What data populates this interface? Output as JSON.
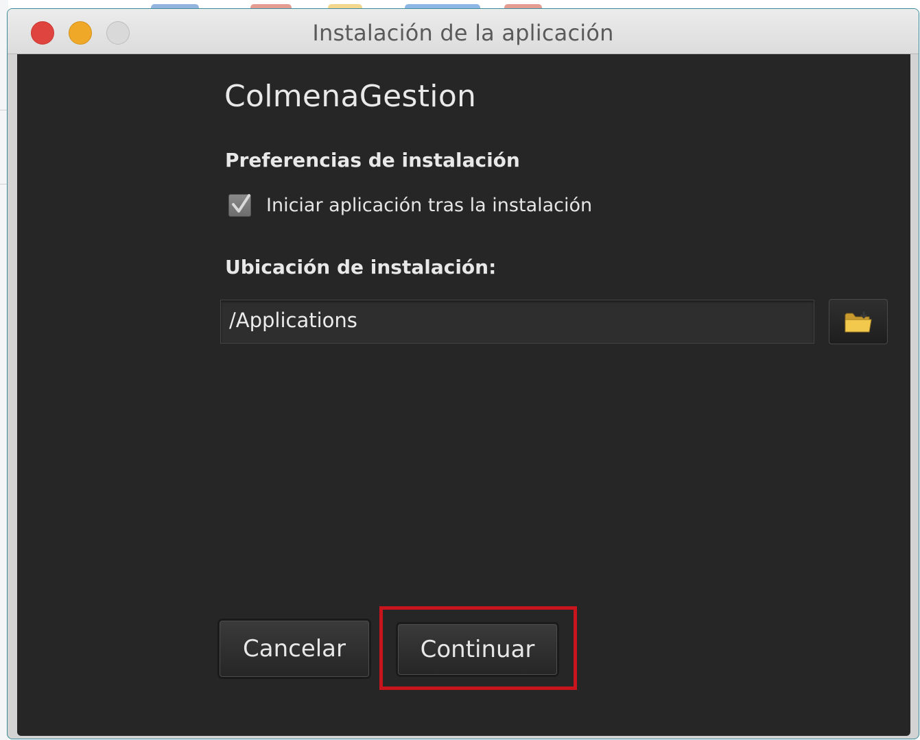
{
  "window": {
    "title": "Instalación de la aplicación"
  },
  "dialog": {
    "app_name": "ColmenaGestion",
    "preferences_heading": "Preferencias de instalación",
    "launch_after_install_label": "Iniciar aplicación tras la instalación",
    "launch_after_install_checked": true,
    "location_heading": "Ubicación de instalación:",
    "location_value": "/Applications",
    "browse_icon": "folder-icon"
  },
  "buttons": {
    "cancel_label": "Cancelar",
    "continue_label": "Continuar"
  },
  "colors": {
    "highlight": "#c8151d",
    "window_close": "#e0443e",
    "window_minimize": "#efa827"
  }
}
